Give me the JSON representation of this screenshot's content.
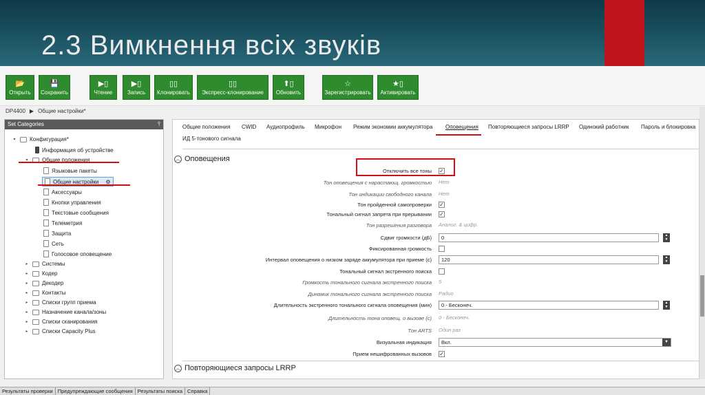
{
  "slide": {
    "title": "2.3 Вимкнення всіх звуків"
  },
  "toolbar": {
    "buttons": [
      {
        "icon": "📂",
        "label": "Открыть"
      },
      {
        "icon": "💾",
        "label": "Сохранить"
      },
      {
        "icon": "▶▯",
        "label": "Чтение"
      },
      {
        "icon": "▶▯",
        "label": "Запись"
      },
      {
        "icon": "▯▯",
        "label": "Клонировать"
      },
      {
        "icon": "▯▯",
        "label": "Экспресс-клонирование"
      },
      {
        "icon": "⬆▯",
        "label": "Обновить"
      },
      {
        "icon": "☆",
        "label": "Зарегистрировать"
      },
      {
        "icon": "★▯",
        "label": "Активировать"
      }
    ]
  },
  "breadcrumb": {
    "device": "DP4400",
    "separator": "▶",
    "page": "Общие настройки*"
  },
  "left_panel": {
    "title": "Set Categories",
    "pin": "⫯",
    "tree": {
      "root": "Конфигурация*",
      "device_info": "Информация об устройстве",
      "general": "Общие положения",
      "lang_packs": "Языковые пакеты",
      "general_settings": "Общие настройки",
      "accessories": "Аксессуары",
      "buttons": "Кнопки управления",
      "text_msgs": "Текстовые сообщения",
      "telemetry": "Телеметрия",
      "protection": "Защита",
      "network": "Сеть",
      "voice_alert": "Голосовое оповещение",
      "systems": "Системы",
      "coder": "Кодер",
      "decoder": "Декодер",
      "contacts": "Контакты",
      "rx_groups": "Списки групп приема",
      "channel_zones": "Назначение канала/зоны",
      "scan_lists": "Списки сканирования",
      "capacity_plus": "Списки Capacity Plus"
    }
  },
  "tabs": [
    "Общие положения",
    "CWID",
    "Аудиопрофиль",
    "Микрофон",
    "Режим экономии аккумулятора",
    "Оповещения",
    "Повторяющиеся запросы LRRP",
    "Одинокий работник",
    "Пароль и блокировка",
    "ИД 5-тонового сигнала"
  ],
  "sections": {
    "alerts": "Оповещения",
    "lrrp": "Повторяющиеся запросы LRRP"
  },
  "fields": {
    "disable_all_tones": "Отключить все тоны",
    "escalating_tone": "Тон оповещения с нарастающ. громкостью",
    "escalating_tone_val": "Нет",
    "free_channel_tone": "Тон индикации свободного канала",
    "free_channel_tone_val": "Нет",
    "self_test_tone": "Тон пройденной самопроверки",
    "interrupt_tone": "Тональный сигнал запрета при прерывании",
    "talk_permit_tone": "Тон разрешения разговора",
    "talk_permit_tone_val": "Аналог. & цифр.",
    "volume_offset": "Сдвиг громкости (дБ)",
    "volume_offset_val": "0",
    "fixed_volume": "Фиксированная громкость",
    "low_batt_interval": "Интервал оповещения о низком заряде аккумулятора при приеме (с)",
    "low_batt_interval_val": "120",
    "emergency_tone": "Тональный сигнал экстренного поиска",
    "emergency_volume": "Громкость тонального сигнала экстренного поиска",
    "emergency_volume_val": "5",
    "emergency_dynamics": "Динамик тонального сигнала экстренного поиска",
    "emergency_dynamics_val": "Радио",
    "emergency_duration": "Длительность экстренного тонального сигнала оповещения (мин)",
    "emergency_duration_val": "0 - Бесконеч.",
    "call_alert_duration": "Длительность тона оповещ. о вызове (с)",
    "call_alert_duration_val": "0 - Бесконеч.",
    "arts_tone": "Тон ARTS",
    "arts_tone_val": "Один раз",
    "visual_indication": "Визуальная индикация",
    "visual_indication_val": "Вкл.",
    "unencrypted_rx": "Прием нешифрованных вызовов"
  },
  "bottom_tabs": [
    "Результаты проверки",
    "Предупреждающие сообщения",
    "Результаты поиска",
    "Справка"
  ],
  "colors": {
    "toolbar_green": "#2e8b2e",
    "highlight_red": "#d01010",
    "header_teal": "#1b5262"
  }
}
